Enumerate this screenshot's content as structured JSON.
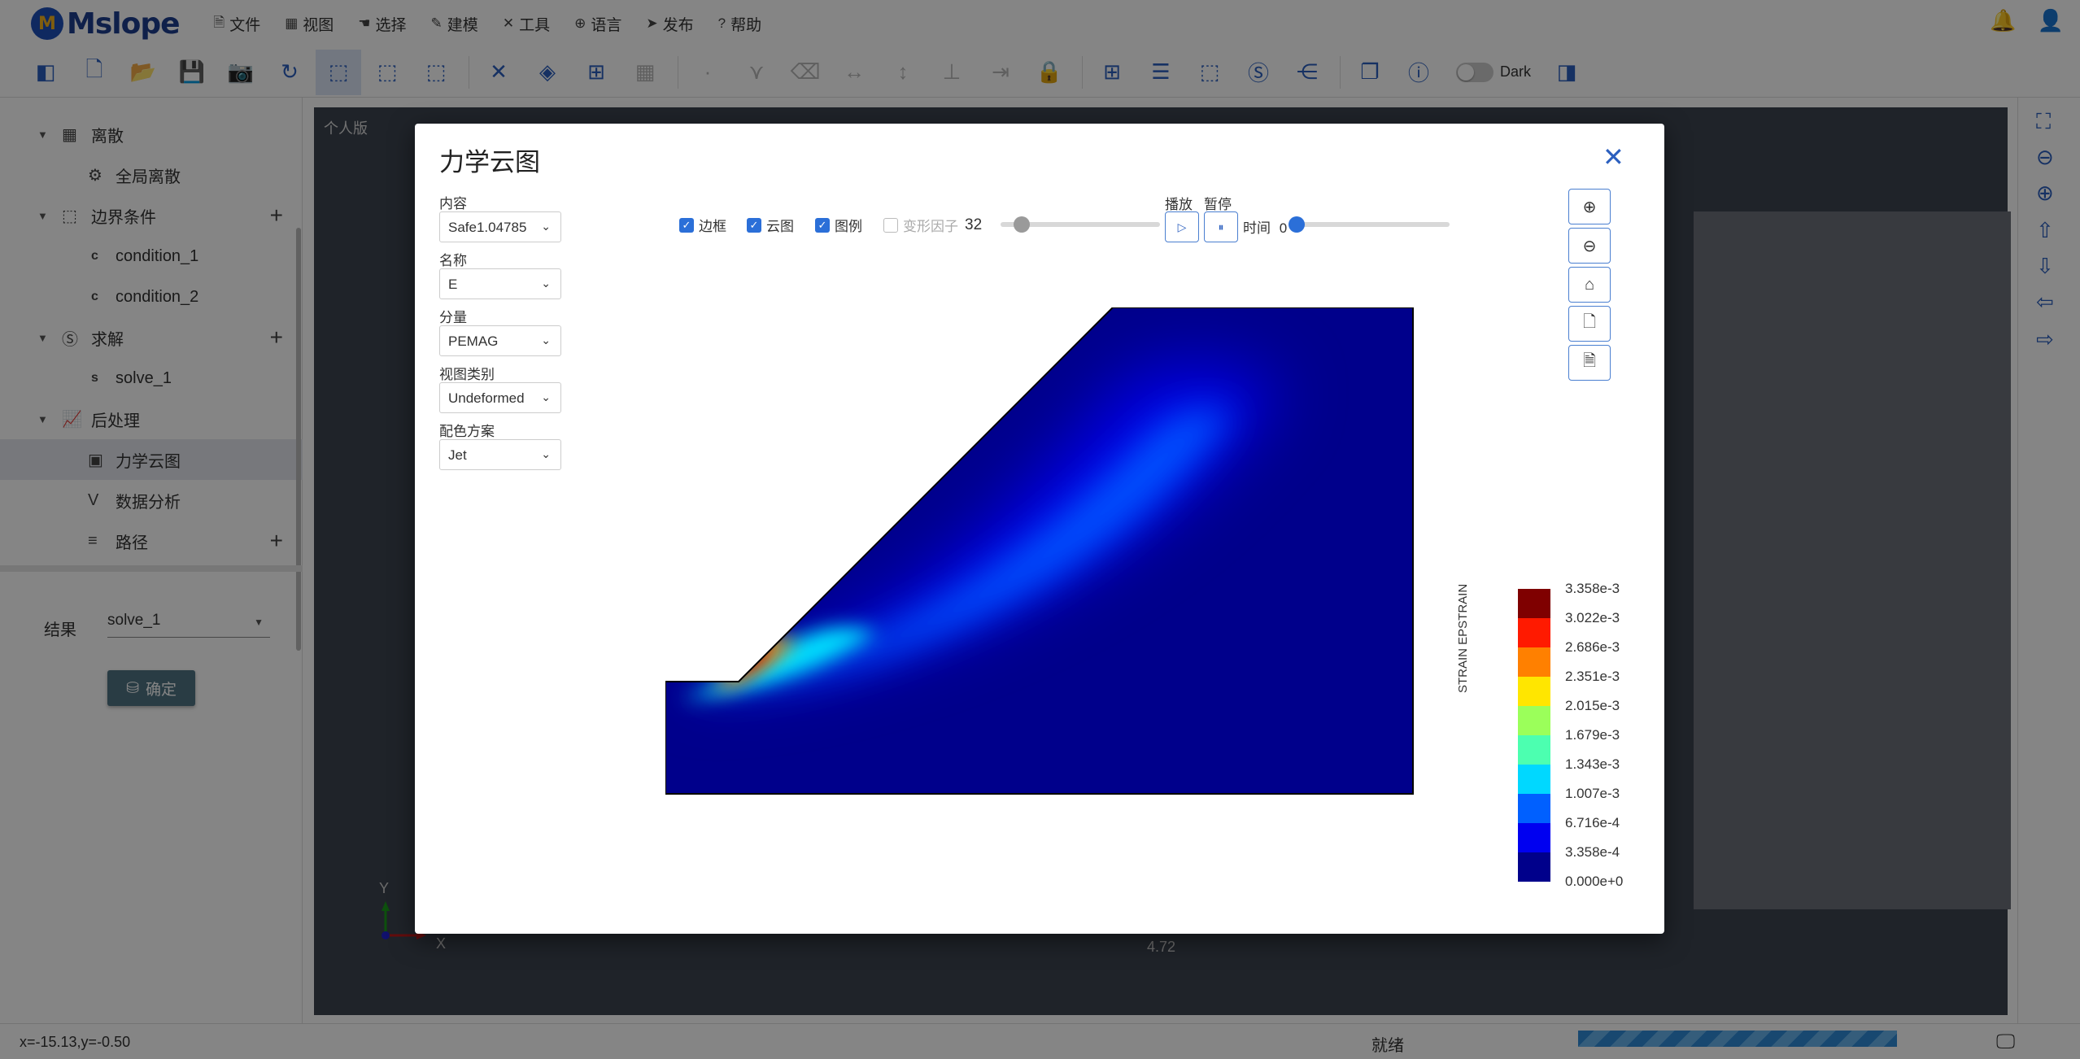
{
  "app": {
    "logo_text": "Mslope",
    "logo_badge": "M"
  },
  "menu": [
    {
      "icon": "file-icon",
      "glyph": "🗎",
      "label": "文件"
    },
    {
      "icon": "grid-icon",
      "glyph": "▦",
      "label": "视图"
    },
    {
      "icon": "hand-icon",
      "glyph": "☚",
      "label": "选择"
    },
    {
      "icon": "pencil-icon",
      "glyph": "✎",
      "label": "建模"
    },
    {
      "icon": "tools-icon",
      "glyph": "✕",
      "label": "工具"
    },
    {
      "icon": "globe-icon",
      "glyph": "⊕",
      "label": "语言"
    },
    {
      "icon": "send-icon",
      "glyph": "➤",
      "label": "发布"
    },
    {
      "icon": "question-icon",
      "glyph": "?",
      "label": "帮助"
    }
  ],
  "toolbar": {
    "dark_label": "Dark"
  },
  "sidebar": {
    "items": [
      {
        "label": "离散",
        "icon": "grid-icon"
      },
      {
        "label": "全局离散",
        "icon": "gear-icon"
      },
      {
        "label": "边界条件",
        "icon": "dotted-box-icon"
      },
      {
        "label": "condition_1",
        "icon": "c-icon"
      },
      {
        "label": "condition_2",
        "icon": "c-icon"
      },
      {
        "label": "求解",
        "icon": "s-circle-icon"
      },
      {
        "label": "solve_1",
        "icon": "s-icon"
      },
      {
        "label": "后处理",
        "icon": "chart-icon"
      },
      {
        "label": "力学云图",
        "icon": "image-icon"
      },
      {
        "label": "数据分析",
        "icon": "v-icon"
      },
      {
        "label": "路径",
        "icon": "path-icon"
      }
    ],
    "result_label": "结果",
    "result_value": "solve_1",
    "confirm_label": "确定"
  },
  "canvas": {
    "edition": "个人版",
    "axis_y": "Y",
    "axis_x": "X",
    "x_value": "4.72"
  },
  "status": {
    "coords": "x=-15.13,y=-0.50",
    "ready": "就绪"
  },
  "modal": {
    "title": "力学云图",
    "fields": [
      {
        "label": "内容",
        "value": "Safe1.04785"
      },
      {
        "label": "名称",
        "value": "E"
      },
      {
        "label": "分量",
        "value": "PEMAG"
      },
      {
        "label": "视图类别",
        "value": "Undeformed"
      },
      {
        "label": "配色方案",
        "value": "Jet"
      }
    ],
    "options": {
      "frame": {
        "label": "边框",
        "checked": true
      },
      "contour": {
        "label": "云图",
        "checked": true
      },
      "legend": {
        "label": "图例",
        "checked": true
      },
      "deform": {
        "label": "变形因子",
        "checked": false,
        "value": "32"
      }
    },
    "play_label": "播放",
    "pause_label": "暂停",
    "time_label": "时间",
    "time_value": "0",
    "legend_title": "STRAIN EPSTRAIN",
    "legend_ticks": [
      "3.358e-3",
      "3.022e-3",
      "2.686e-3",
      "2.351e-3",
      "2.015e-3",
      "1.679e-3",
      "1.343e-3",
      "1.007e-3",
      "6.716e-4",
      "3.358e-4",
      "0.000e+0"
    ],
    "legend_colors": [
      "#7f0000",
      "#ff1a00",
      "#ff8000",
      "#ffe600",
      "#9bff5a",
      "#4cffb0",
      "#00d8ff",
      "#0060ff",
      "#0000f0",
      "#00008b"
    ]
  }
}
